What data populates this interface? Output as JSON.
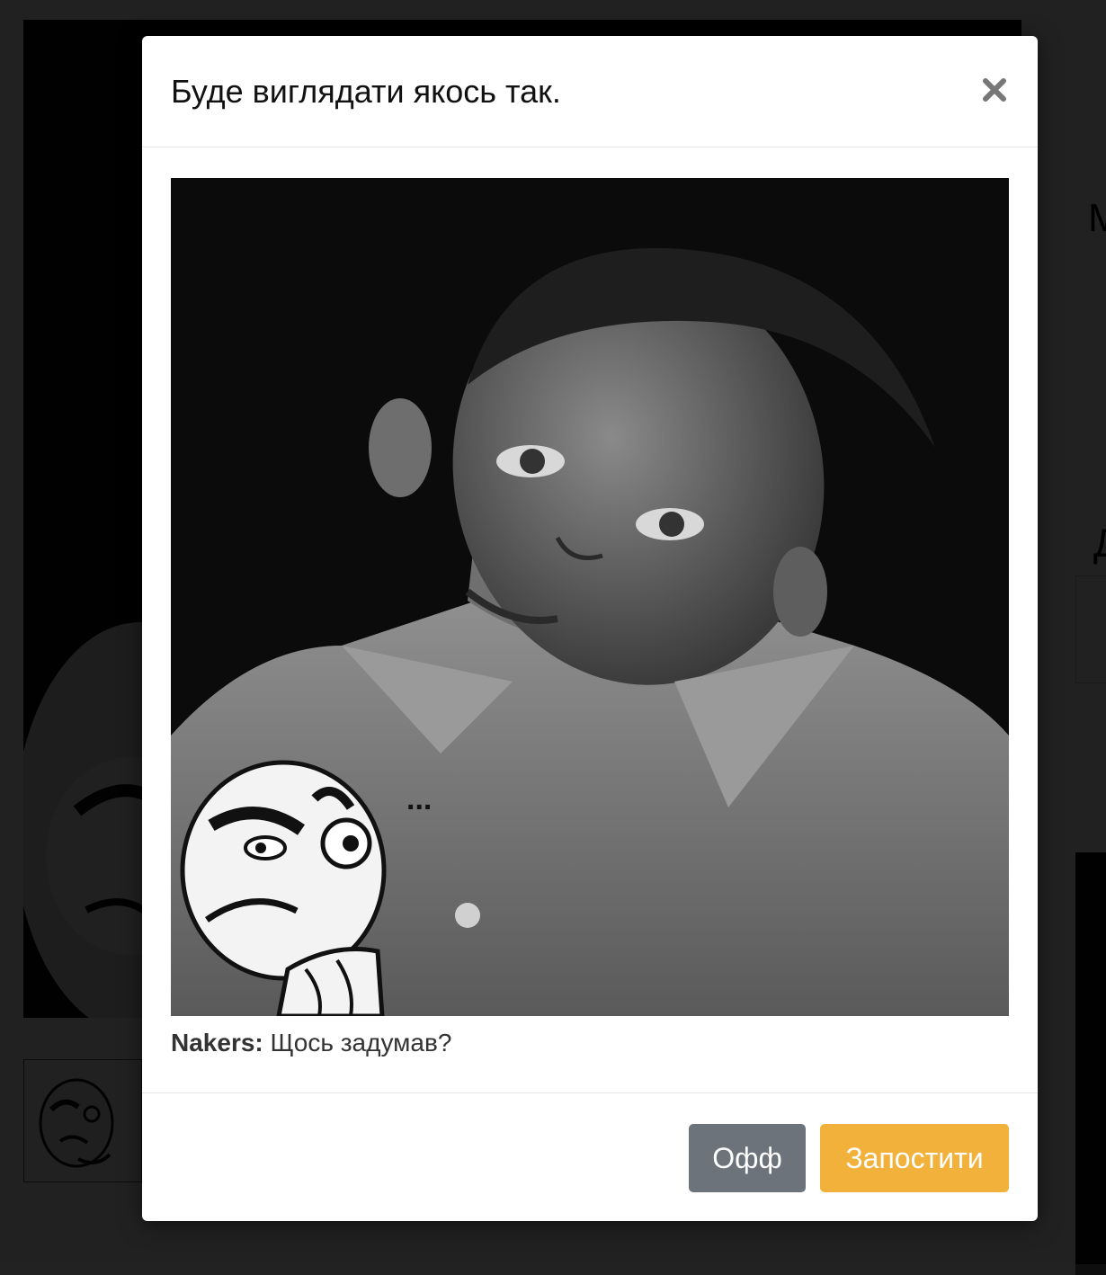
{
  "modal": {
    "title": "Буде виглядати якось так.",
    "close_symbol": "×",
    "preview": {
      "overlay_text": "..."
    },
    "caption": {
      "author": "Nakers:",
      "text": "Щось задумав?"
    },
    "buttons": {
      "off_label": "Офф",
      "post_label": "Запостити"
    }
  },
  "colors": {
    "overlay": "#000000",
    "modal_bg": "#ffffff",
    "off_button": "#6c737b",
    "post_button": "#f1b13b",
    "title_text": "#111111",
    "close_icon": "#777777"
  },
  "icons": {
    "close": "close-icon",
    "rage_face": "thinking-rage-face-icon"
  }
}
